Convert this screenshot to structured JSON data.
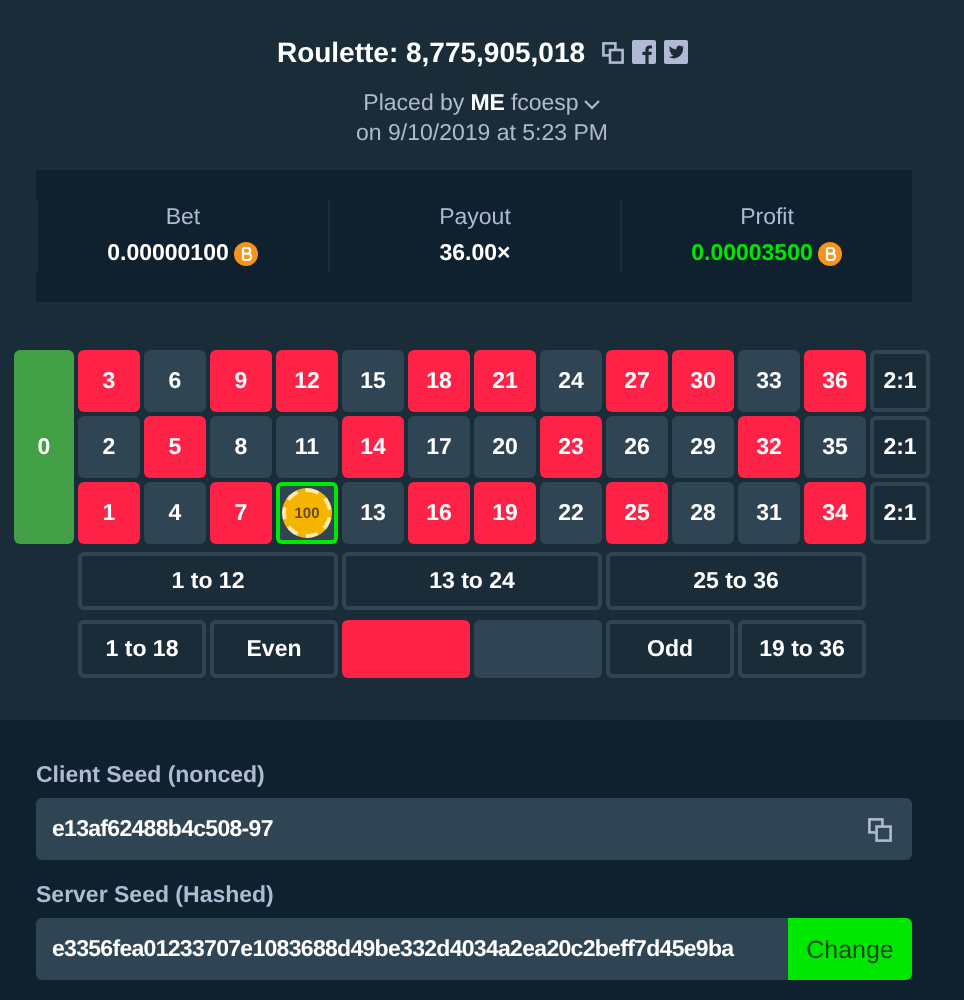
{
  "title": "Roulette: 8,775,905,018",
  "placed_by": {
    "prefix": "Placed by",
    "badge": "ME",
    "user": "fcoesp"
  },
  "date": "on 9/10/2019 at 5:23 PM",
  "stats": [
    {
      "label": "Bet",
      "value": "0.00000100",
      "kind": "amount"
    },
    {
      "label": "Payout",
      "value": "36.00×",
      "kind": "multiplier"
    },
    {
      "label": "Profit",
      "value": "0.00003500",
      "kind": "profit"
    }
  ],
  "board": {
    "zero": "0",
    "numbers": [
      {
        "label": "3",
        "color": "#fe2247",
        "selected": false
      },
      {
        "label": "6",
        "color": "#2f4553",
        "selected": false
      },
      {
        "label": "9",
        "color": "#fe2247",
        "selected": false
      },
      {
        "label": "12",
        "color": "#fe2247",
        "selected": false
      },
      {
        "label": "15",
        "color": "#2f4553",
        "selected": false
      },
      {
        "label": "18",
        "color": "#fe2247",
        "selected": false
      },
      {
        "label": "21",
        "color": "#fe2247",
        "selected": false
      },
      {
        "label": "24",
        "color": "#2f4553",
        "selected": false
      },
      {
        "label": "27",
        "color": "#fe2247",
        "selected": false
      },
      {
        "label": "30",
        "color": "#fe2247",
        "selected": false
      },
      {
        "label": "33",
        "color": "#2f4553",
        "selected": false
      },
      {
        "label": "36",
        "color": "#fe2247",
        "selected": false
      },
      {
        "label": "2",
        "color": "#2f4553",
        "selected": false
      },
      {
        "label": "5",
        "color": "#fe2247",
        "selected": false
      },
      {
        "label": "8",
        "color": "#2f4553",
        "selected": false
      },
      {
        "label": "11",
        "color": "#2f4553",
        "selected": false
      },
      {
        "label": "14",
        "color": "#fe2247",
        "selected": false
      },
      {
        "label": "17",
        "color": "#2f4553",
        "selected": false
      },
      {
        "label": "20",
        "color": "#2f4553",
        "selected": false
      },
      {
        "label": "23",
        "color": "#fe2247",
        "selected": false
      },
      {
        "label": "26",
        "color": "#2f4553",
        "selected": false
      },
      {
        "label": "29",
        "color": "#2f4553",
        "selected": false
      },
      {
        "label": "32",
        "color": "#fe2247",
        "selected": false
      },
      {
        "label": "35",
        "color": "#2f4553",
        "selected": false
      },
      {
        "label": "1",
        "color": "#fe2247",
        "selected": false
      },
      {
        "label": "4",
        "color": "#2f4553",
        "selected": false
      },
      {
        "label": "7",
        "color": "#fe2247",
        "selected": false
      },
      {
        "chip": "100",
        "color": "#2f4553",
        "selected": true
      },
      {
        "label": "13",
        "color": "#2f4553",
        "selected": false
      },
      {
        "label": "16",
        "color": "#fe2247",
        "selected": false
      },
      {
        "label": "19",
        "color": "#fe2247",
        "selected": false
      },
      {
        "label": "22",
        "color": "#2f4553",
        "selected": false
      },
      {
        "label": "25",
        "color": "#fe2247",
        "selected": false
      },
      {
        "label": "28",
        "color": "#2f4553",
        "selected": false
      },
      {
        "label": "31",
        "color": "#2f4553",
        "selected": false
      },
      {
        "label": "34",
        "color": "#fe2247",
        "selected": false
      }
    ],
    "column_bets": [
      "2:1",
      "2:1",
      "2:1"
    ],
    "dozens": [
      "1 to 12",
      "13 to 24",
      "25 to 36"
    ],
    "outside": [
      {
        "kind": "text",
        "label": "1 to 18"
      },
      {
        "kind": "text",
        "label": "Even"
      },
      {
        "kind": "swatch",
        "color": "#fe2247"
      },
      {
        "kind": "swatch",
        "color": "#2f4553"
      },
      {
        "kind": "text",
        "label": "Odd"
      },
      {
        "kind": "text",
        "label": "19 to 36"
      }
    ]
  },
  "client_seed": {
    "label": "Client Seed (nonced)",
    "value": "e13af62488b4c508-97"
  },
  "server_seed": {
    "label": "Server Seed (Hashed)",
    "value": "e3356fea01233707e1083688d49be332d4034a2ea20c2beff7d45e9ba",
    "button": "Change"
  }
}
